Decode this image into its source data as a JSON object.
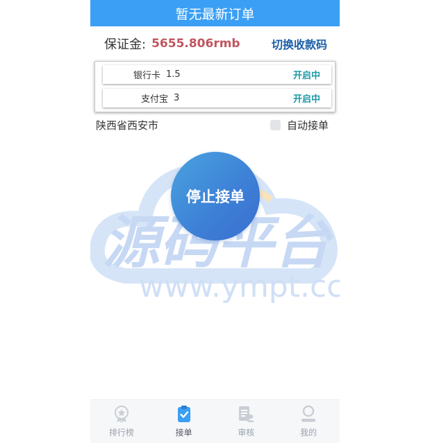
{
  "header": {
    "title": "暂无最新订单"
  },
  "deposit": {
    "label": "保证金:",
    "value": "5655.806rmb",
    "switch_label": "切换收款码"
  },
  "channels": [
    {
      "name": "银行卡",
      "rate": "1.5",
      "status": "开启中"
    },
    {
      "name": "支付宝",
      "rate": "3",
      "status": "开启中"
    }
  ],
  "location": {
    "text": "陕西省西安市",
    "auto_accept_label": "自动接单"
  },
  "stop_button": {
    "label": "停止接单"
  },
  "watermark": {
    "brand": "源码平台",
    "url": "www.ympt.cc"
  },
  "tabbar": {
    "items": [
      {
        "label": "排行榜",
        "icon": "award-icon"
      },
      {
        "label": "接单",
        "icon": "clipboard-check-icon",
        "active": true
      },
      {
        "label": "审核",
        "icon": "audit-icon"
      },
      {
        "label": "我的",
        "icon": "user-icon"
      }
    ]
  },
  "colors": {
    "header_bg": "#3a9ff5",
    "deposit_value": "#c0555f",
    "link": "#1a5fa8",
    "status": "#1e9aa5",
    "tab_active_icon": "#3a9ff5"
  }
}
